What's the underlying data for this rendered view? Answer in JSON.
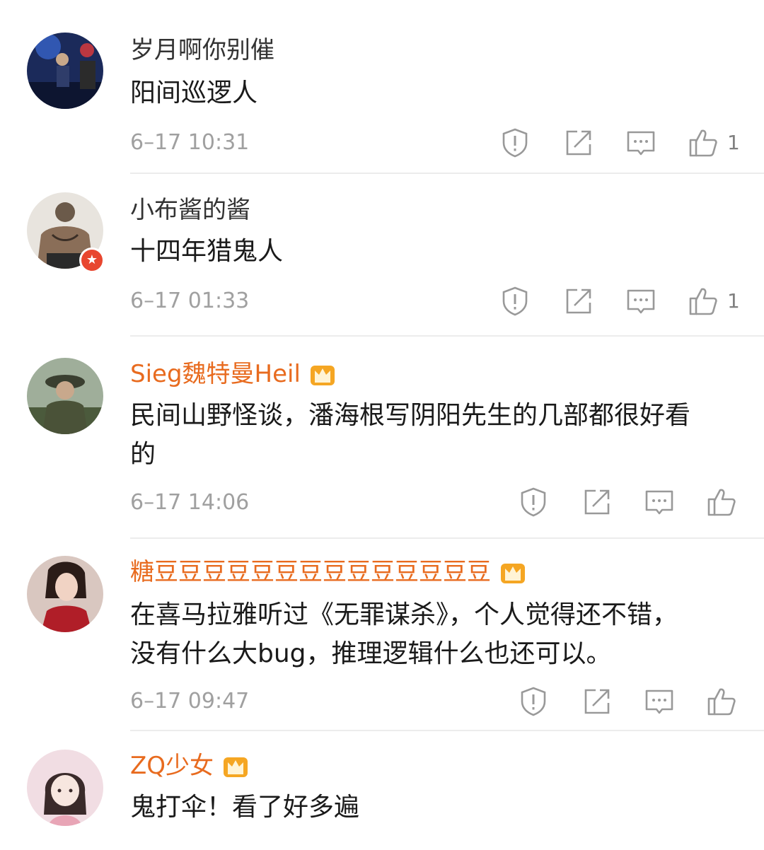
{
  "comments": [
    {
      "username": "岁月啊你别催",
      "text": "阳间巡逻人",
      "time": "6–17 10:31",
      "likes": "1",
      "vip": false,
      "verified": false
    },
    {
      "username": "小布酱的酱",
      "text": "十四年猎鬼人",
      "time": "6–17 01:33",
      "likes": "1",
      "vip": false,
      "verified": true
    },
    {
      "username": "Sieg魏特曼Heil",
      "text": "民间山野怪谈，潘海根写阴阳先生的几部都很好看\n的",
      "time": "6–17 14:06",
      "likes": "",
      "vip": true,
      "verified": false
    },
    {
      "username": "糖豆豆豆豆豆豆豆豆豆豆豆豆豆豆",
      "text": "在喜马拉雅听过《无罪谋杀》，个人觉得还不错，\n没有什么大bug，推理逻辑什么也还可以。",
      "time": "6–17 09:47",
      "likes": "",
      "vip": true,
      "verified": false
    },
    {
      "username": "ZQ少女",
      "text": "鬼打伞！看了好多遍",
      "time": "",
      "likes": "",
      "vip": true,
      "verified": false
    }
  ],
  "icons": {
    "report": "report-icon",
    "repost": "repost-icon",
    "reply": "reply-icon",
    "like": "thumbs-up-icon",
    "crown": "vip-crown-icon",
    "verified": "verified-badge-icon"
  },
  "colors": {
    "vip_name": "#e86b1f",
    "normal_name": "#333333",
    "time": "#a0a0a0",
    "icon": "#999999",
    "verified_badge": "#e8462f",
    "crown": "#f5a623"
  }
}
